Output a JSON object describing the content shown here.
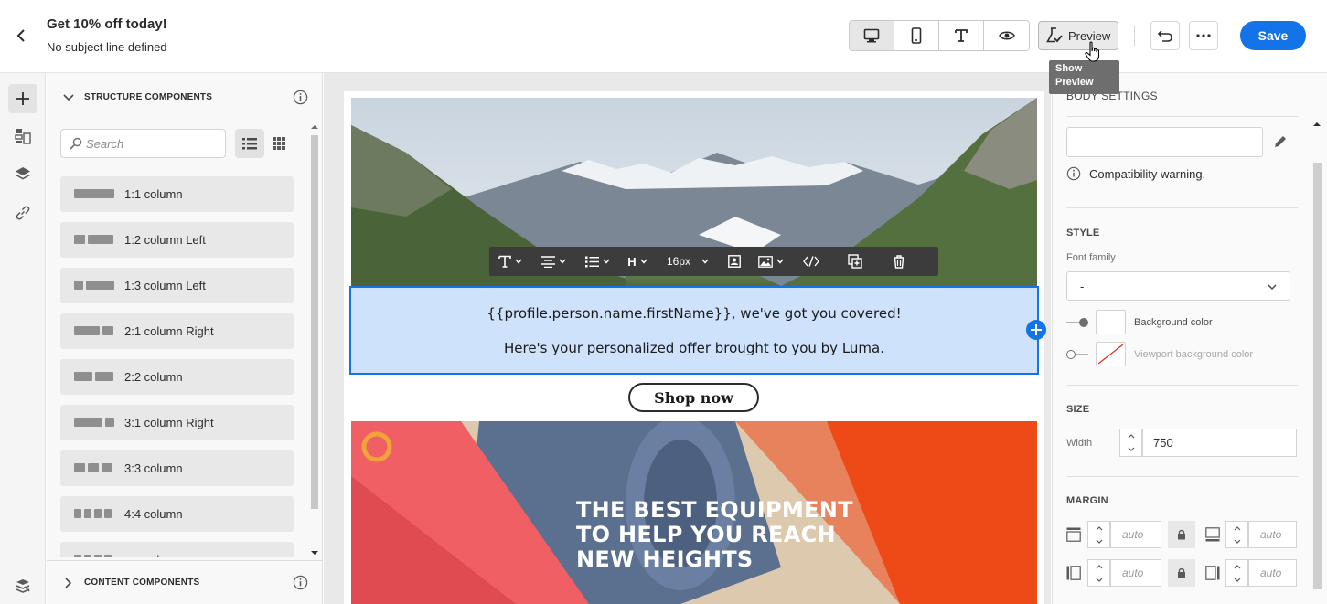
{
  "header": {
    "title": "Get 10% off today!",
    "subtitle": "No subject line defined",
    "preview_label": "Preview",
    "tooltip": "Show Preview",
    "save_label": "Save"
  },
  "panel": {
    "structure_title": "STRUCTURE COMPONENTS",
    "search_placeholder": "Search",
    "items": [
      {
        "label": "1:1 column",
        "bars": [
          44
        ]
      },
      {
        "label": "1:2 column Left",
        "bars": [
          12,
          28
        ]
      },
      {
        "label": "1:3 column Left",
        "bars": [
          10,
          31
        ]
      },
      {
        "label": "2:1 column Right",
        "bars": [
          28,
          12
        ]
      },
      {
        "label": "2:2 column",
        "bars": [
          20,
          20
        ]
      },
      {
        "label": "3:1 column Right",
        "bars": [
          31,
          10
        ]
      },
      {
        "label": "3:3 column",
        "bars": [
          12,
          12,
          12
        ]
      },
      {
        "label": "4:4 column",
        "bars": [
          8,
          8,
          8,
          8
        ]
      },
      {
        "label": "n:n column",
        "bars": [
          8,
          8,
          8,
          8
        ]
      }
    ],
    "content_title": "CONTENT COMPONENTS"
  },
  "canvas": {
    "toolbar": {
      "heading": "H",
      "font_size": "16px"
    },
    "line1": "{{profile.person.name.firstName}}, we've got you covered!",
    "line2": "Here's your personalized offer brought to you by Luma.",
    "button": "Shop now",
    "banner_lines": [
      "THE BEST EQUIPMENT",
      "TO HELP YOU REACH",
      "NEW HEIGHTS"
    ]
  },
  "props": {
    "body_settings": "BODY SETTINGS",
    "compat": "Compatibility warning.",
    "style": "STYLE",
    "font_family": "Font family",
    "font_value": "-",
    "bg_color": "Background color",
    "viewport_bg": "Viewport background color",
    "size": "SIZE",
    "width_label": "Width",
    "width_value": "750",
    "margin": "MARGIN",
    "auto": "auto"
  },
  "colors": {
    "accent": "#1473e6",
    "selection_bg": "#cfe2fb",
    "toolbar_bg": "#3c3c3c",
    "banner": "#e94d1d"
  }
}
